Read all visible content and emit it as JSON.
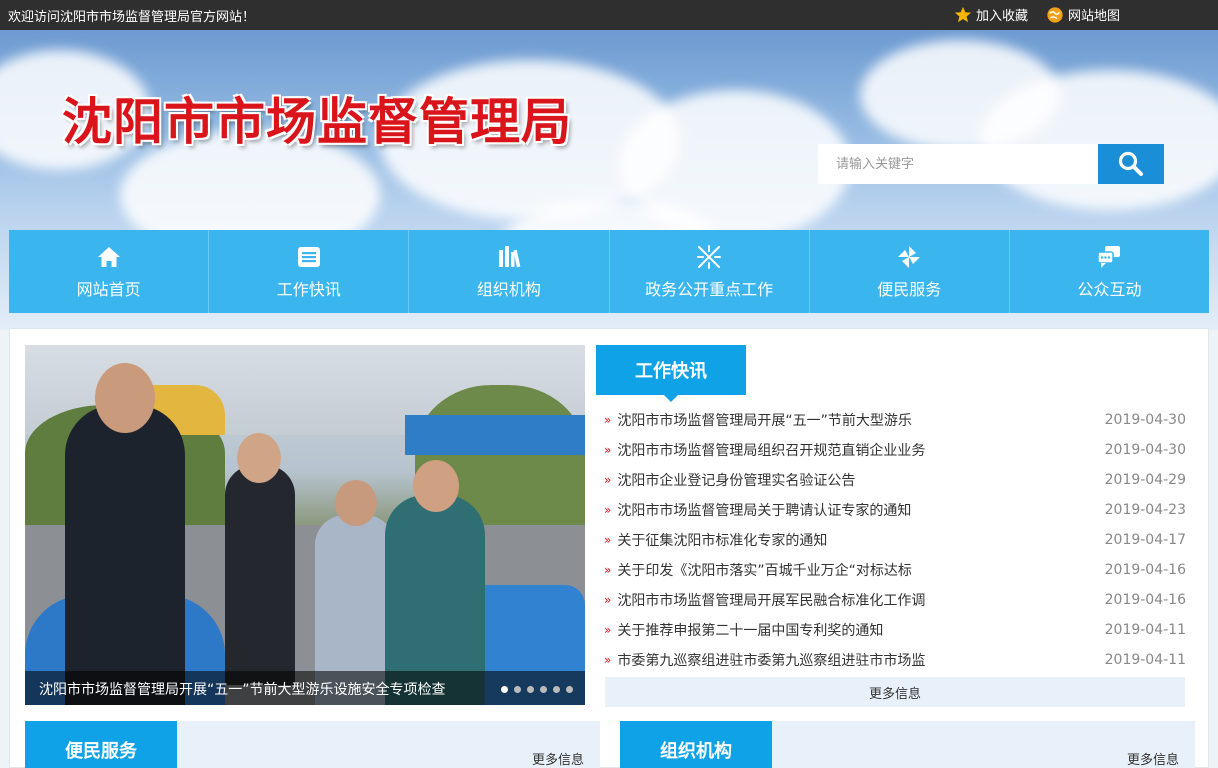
{
  "topbar": {
    "welcome": "欢迎访问沈阳市市场监督管理局官方网站！",
    "bookmark": "加入收藏",
    "sitemap": "网站地图"
  },
  "header": {
    "title": "沈阳市市场监督管理局",
    "search_placeholder": "请输入关键字"
  },
  "nav": [
    {
      "label": "网站首页",
      "icon": "home-icon"
    },
    {
      "label": "工作快讯",
      "icon": "news-icon"
    },
    {
      "label": "组织机构",
      "icon": "books-icon"
    },
    {
      "label": "政务公开重点工作",
      "icon": "sparkle-icon"
    },
    {
      "label": "便民服务",
      "icon": "pinwheel-icon"
    },
    {
      "label": "公众互动",
      "icon": "chat-icon"
    }
  ],
  "slider": {
    "caption": "沈阳市市场监督管理局开展“五一”节前大型游乐设施安全专项检查",
    "dot_count": 6,
    "active_dot": 1
  },
  "news": {
    "tab": "工作快讯",
    "more": "更多信息",
    "items": [
      {
        "title": "沈阳市市场监督管理局开展“五一”节前大型游乐",
        "date": "2019-04-30"
      },
      {
        "title": "沈阳市市场监督管理局组织召开规范直销企业业务",
        "date": "2019-04-30"
      },
      {
        "title": "沈阳市企业登记身份管理实名验证公告",
        "date": "2019-04-29"
      },
      {
        "title": "沈阳市市场监督管理局关于聘请认证专家的通知",
        "date": "2019-04-23"
      },
      {
        "title": "关于征集沈阳市标准化专家的通知",
        "date": "2019-04-17"
      },
      {
        "title": "关于印发《沈阳市落实”百城千业万企“对标达标",
        "date": "2019-04-16"
      },
      {
        "title": "沈阳市市场监督管理局开展军民融合标准化工作调",
        "date": "2019-04-16"
      },
      {
        "title": "关于推荐申报第二十一届中国专利奖的通知",
        "date": "2019-04-11"
      },
      {
        "title": "市委第九巡察组进驻市委第九巡察组进驻市市场监",
        "date": "2019-04-11"
      }
    ]
  },
  "sections": [
    {
      "tab": "便民服务",
      "more": "更多信息"
    },
    {
      "tab": "组织机构",
      "more": "更多信息"
    }
  ],
  "colors": {
    "nav_bg": "#3bb5ee",
    "tab_bg": "#0fa2e6",
    "title_red": "#d9141a",
    "topbar_bg": "#2f2f2f"
  }
}
